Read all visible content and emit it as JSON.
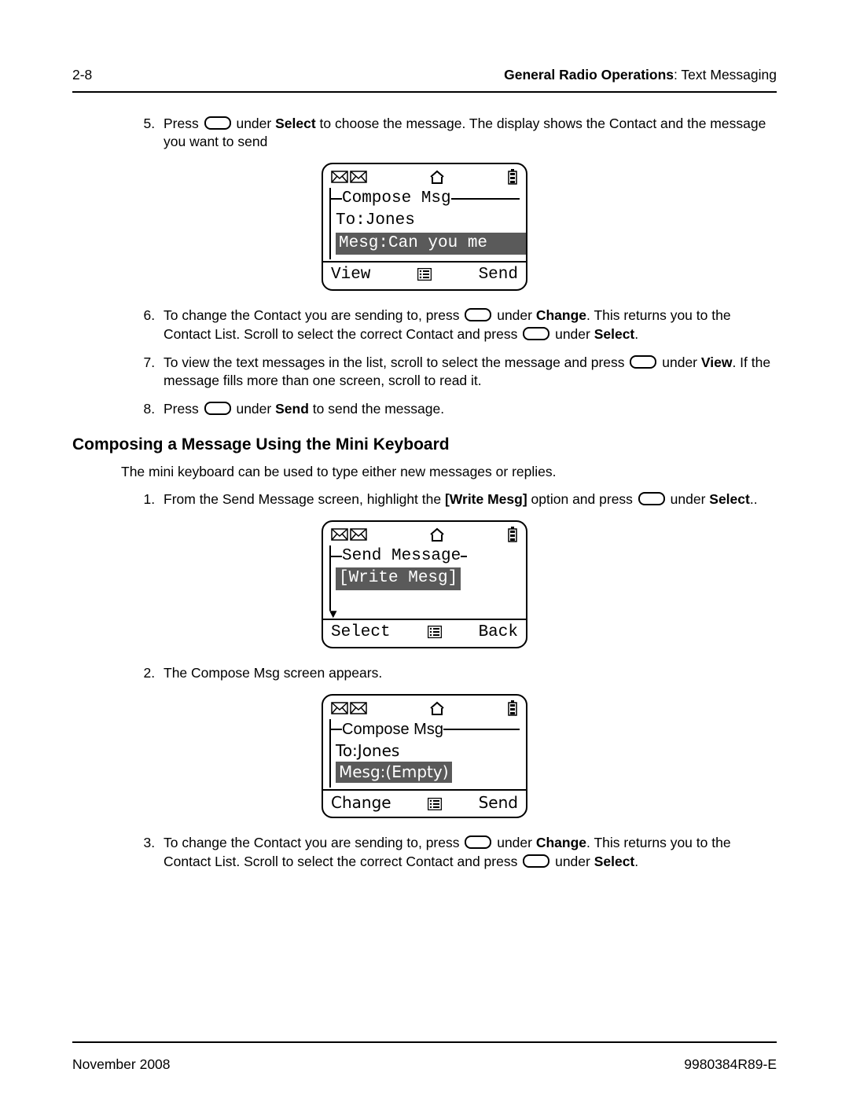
{
  "header": {
    "page_no": "2-8",
    "section_bold": "General Radio Operations",
    "section_rest": ": Text Messaging"
  },
  "footer": {
    "date": "November 2008",
    "doc_no": "9980384R89-E"
  },
  "steps_a": {
    "s5_a": "Press ",
    "s5_b": " under ",
    "s5_c": "Select",
    "s5_d": " to choose the message. The display shows the Contact and the message you want to send",
    "s6_a": "To change the Contact you are sending to, press ",
    "s6_b": " under ",
    "s6_c": "Change",
    "s6_d": ". This returns you to the Contact List. Scroll to select the correct Contact and press ",
    "s6_e": " under ",
    "s6_f": "Select",
    "s6_g": ".",
    "s7_a": "To view the text messages in the list, scroll to select the message and press ",
    "s7_b": " under ",
    "s7_c": "View",
    "s7_d": ". If the message fills more than one screen, scroll to read it.",
    "s8_a": "Press ",
    "s8_b": " under ",
    "s8_c": "Send",
    "s8_d": " to send the message."
  },
  "heading": "Composing a Message Using the Mini Keyboard",
  "intro": "The mini keyboard can be used to type either new messages or replies.",
  "steps_b": {
    "s1_a": "From the Send Message screen, highlight the ",
    "s1_b": "[Write Mesg]",
    "s1_c": " option and press ",
    "s1_d": " under ",
    "s1_e": "Select",
    "s1_f": "..",
    "s2": "The Compose Msg screen appears.",
    "s3_a": "To change the Contact you are sending to, press ",
    "s3_b": " under ",
    "s3_c": "Change",
    "s3_d": ". This returns you to the Contact List. Scroll to select the correct Contact and press ",
    "s3_e": " under ",
    "s3_f": "Select",
    "s3_g": "."
  },
  "screen1": {
    "title": "Compose Msg",
    "line1": "To:Jones",
    "line2": "Mesg:Can you me",
    "left": "View",
    "right": "Send"
  },
  "screen2": {
    "title": "Send Message",
    "line1": "[Write Mesg]",
    "left": "Select",
    "right": "Back"
  },
  "screen3": {
    "title": "Compose Msg",
    "line1": "To:Jones",
    "line2": "Mesg:(Empty)",
    "left": "Change",
    "right": "Send"
  }
}
